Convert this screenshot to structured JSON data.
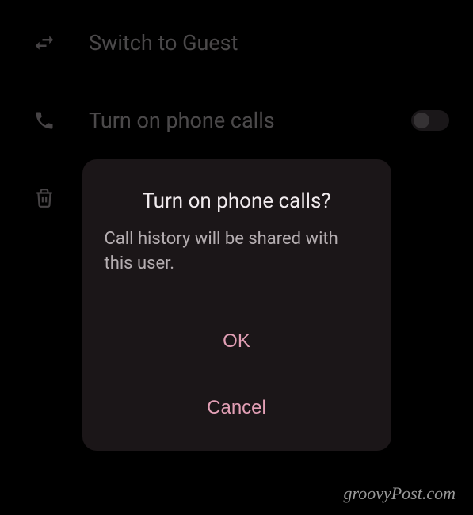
{
  "settings": {
    "items": [
      {
        "label": "Switch to Guest",
        "icon": "swap-icon",
        "hasToggle": false
      },
      {
        "label": "Turn on phone calls",
        "icon": "phone-icon",
        "hasToggle": true
      }
    ],
    "delete_icon": "trash-icon"
  },
  "dialog": {
    "title": "Turn on phone calls?",
    "message": "Call history will be shared with this user.",
    "ok_label": "OK",
    "cancel_label": "Cancel"
  },
  "watermark": "groovyPost.com"
}
